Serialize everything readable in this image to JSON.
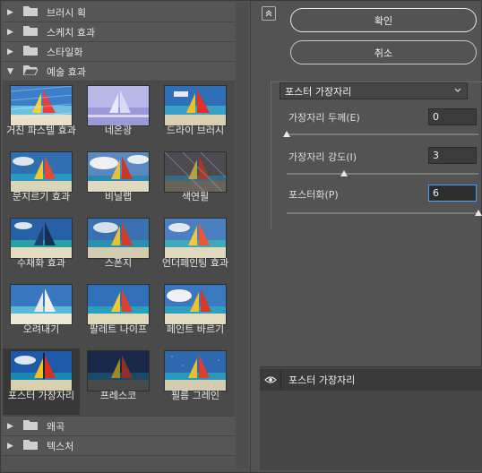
{
  "categories_top": [
    {
      "label": "브러시 획",
      "expanded": false
    },
    {
      "label": "스케치 효과",
      "expanded": false
    },
    {
      "label": "스타일화",
      "expanded": false
    },
    {
      "label": "예술 효과",
      "expanded": true
    }
  ],
  "filters": [
    {
      "label": "거친 파스텔 효과",
      "icon": "rough-pastels-thumbnail"
    },
    {
      "label": "네온광",
      "icon": "neon-glow-thumbnail"
    },
    {
      "label": "드라이 브러시",
      "icon": "dry-brush-thumbnail"
    },
    {
      "label": "문지르기 효과",
      "icon": "smudge-stick-thumbnail"
    },
    {
      "label": "비닐랩",
      "icon": "plastic-wrap-thumbnail"
    },
    {
      "label": "색연필",
      "icon": "colored-pencil-thumbnail"
    },
    {
      "label": "수채화 효과",
      "icon": "watercolor-thumbnail"
    },
    {
      "label": "스폰지",
      "icon": "sponge-thumbnail"
    },
    {
      "label": "언더페인팅 효과",
      "icon": "underpainting-thumbnail"
    },
    {
      "label": "오려내기",
      "icon": "cutout-thumbnail"
    },
    {
      "label": "팔레트 나이프",
      "icon": "palette-knife-thumbnail"
    },
    {
      "label": "페인트 바르기",
      "icon": "paint-daubs-thumbnail"
    },
    {
      "label": "포스터 가장자리",
      "icon": "poster-edges-thumbnail",
      "selected": true
    },
    {
      "label": "프레스코",
      "icon": "fresco-thumbnail"
    },
    {
      "label": "필름 그레인",
      "icon": "film-grain-thumbnail"
    }
  ],
  "categories_bottom": [
    {
      "label": "왜곡",
      "expanded": false
    },
    {
      "label": "텍스처",
      "expanded": false
    }
  ],
  "buttons": {
    "ok": "확인",
    "cancel": "취소"
  },
  "settings": {
    "filter_name": "포스터 가장자리",
    "params": [
      {
        "label": "가장자리 두께(E)",
        "value": "0",
        "level": 0.0
      },
      {
        "label": "가장자리 강도(I)",
        "value": "3",
        "level": 0.3
      },
      {
        "label": "포스터화(P)",
        "value": "6",
        "level": 1.0
      }
    ]
  },
  "layers": {
    "active": "포스터 가장자리"
  },
  "colors": {
    "panel_bg": "#535353",
    "selected_bg": "#383838",
    "focus_border": "#4aa0ff"
  }
}
